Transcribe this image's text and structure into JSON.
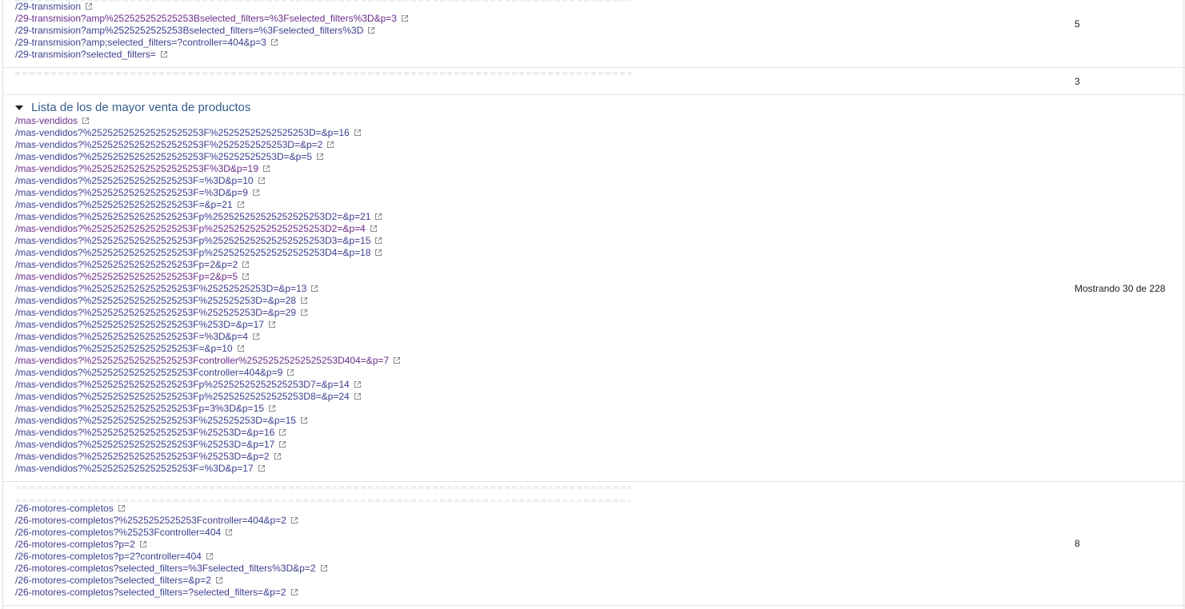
{
  "groups": [
    {
      "links": [
        {
          "url": "/29-transmision",
          "visited": false
        },
        {
          "url": "/29-transmision?amp%252525252525253Bselected_filters=%3Fselected_filters%3D&p=3",
          "visited": true
        },
        {
          "url": "/29-transmision?amp%2525252525253Bselected_filters=%3Fselected_filters%3D",
          "visited": false
        },
        {
          "url": "/29-transmision?amp;selected_filters=?controller=404&p=3",
          "visited": false
        },
        {
          "url": "/29-transmision?selected_filters=",
          "visited": false
        }
      ],
      "count": "5"
    },
    {
      "links": [],
      "count": "3"
    },
    {
      "title": "Lista de los de mayor venta de productos",
      "links": [
        {
          "url": "/mas-vendidos",
          "visited": true
        },
        {
          "url": "/mas-vendidos?%252525252525252525253F%25252525252525253D=&p=16",
          "visited": false
        },
        {
          "url": "/mas-vendidos?%252525252525252525253F%2525252525253D=&p=2",
          "visited": false
        },
        {
          "url": "/mas-vendidos?%252525252525252525253F%25252525253D=&p=5",
          "visited": false
        },
        {
          "url": "/mas-vendidos?%252525252525252525253F%3D&p=19",
          "visited": true
        },
        {
          "url": "/mas-vendidos?%2525252525252525253F=%3D&p=10",
          "visited": false
        },
        {
          "url": "/mas-vendidos?%2525252525252525253F=%3D&p=9",
          "visited": false
        },
        {
          "url": "/mas-vendidos?%2525252525252525253F=&p=21",
          "visited": false
        },
        {
          "url": "/mas-vendidos?%2525252525252525253Fp%252525252525252525253D2=&p=21",
          "visited": false
        },
        {
          "url": "/mas-vendidos?%2525252525252525253Fp%252525252525252525253D2=&p=4",
          "visited": true
        },
        {
          "url": "/mas-vendidos?%2525252525252525253Fp%252525252525252525253D3=&p=15",
          "visited": false
        },
        {
          "url": "/mas-vendidos?%2525252525252525253Fp%252525252525252525253D4=&p=18",
          "visited": false
        },
        {
          "url": "/mas-vendidos?%2525252525252525253Fp=2&p=2",
          "visited": false
        },
        {
          "url": "/mas-vendidos?%2525252525252525253Fp=2&p=5",
          "visited": true
        },
        {
          "url": "/mas-vendidos?%2525252525252525253F%25252525253D=&p=13",
          "visited": false
        },
        {
          "url": "/mas-vendidos?%2525252525252525253F%252525253D=&p=28",
          "visited": false
        },
        {
          "url": "/mas-vendidos?%2525252525252525253F%252525253D=&p=29",
          "visited": false
        },
        {
          "url": "/mas-vendidos?%2525252525252525253F%253D=&p=17",
          "visited": false
        },
        {
          "url": "/mas-vendidos?%2525252525252525253F=%3D&p=4",
          "visited": false
        },
        {
          "url": "/mas-vendidos?%2525252525252525253F=&p=10",
          "visited": false
        },
        {
          "url": "/mas-vendidos?%2525252525252525253Fcontroller%25252525252525253D404=&p=7",
          "visited": true
        },
        {
          "url": "/mas-vendidos?%2525252525252525253Fcontroller=404&p=9",
          "visited": false
        },
        {
          "url": "/mas-vendidos?%2525252525252525253Fp%25252525252525253D7=&p=14",
          "visited": false
        },
        {
          "url": "/mas-vendidos?%2525252525252525253Fp%25252525252525253D8=&p=24",
          "visited": false
        },
        {
          "url": "/mas-vendidos?%2525252525252525253Fp=3%3D&p=15",
          "visited": false
        },
        {
          "url": "/mas-vendidos?%2525252525252525253F%252525253D=&p=15",
          "visited": false
        },
        {
          "url": "/mas-vendidos?%2525252525252525253F%25253D=&p=16",
          "visited": false
        },
        {
          "url": "/mas-vendidos?%2525252525252525253F%25253D=&p=17",
          "visited": false
        },
        {
          "url": "/mas-vendidos?%2525252525252525253F%25253D=&p=2",
          "visited": false
        },
        {
          "url": "/mas-vendidos?%2525252525252525253F=%3D&p=17",
          "visited": false
        }
      ],
      "count": "Mostrando 30 de 228"
    },
    {
      "links": [
        {
          "url": "/26-motores-completos",
          "visited": false
        },
        {
          "url": "/26-motores-completos?%2525252525253Fcontroller=404&p=2",
          "visited": false
        },
        {
          "url": "/26-motores-completos?%25253Fcontroller=404",
          "visited": false
        },
        {
          "url": "/26-motores-completos?p=2",
          "visited": false
        },
        {
          "url": "/26-motores-completos?p=2?controller=404",
          "visited": false
        },
        {
          "url": "/26-motores-completos?selected_filters=%3Fselected_filters%3D&p=2",
          "visited": false
        },
        {
          "url": "/26-motores-completos?selected_filters=&p=2",
          "visited": false
        },
        {
          "url": "/26-motores-completos?selected_filters=?selected_filters=&p=2",
          "visited": false
        }
      ],
      "count": "8"
    }
  ],
  "colors": {
    "link": "#3b3f8f",
    "visited": "#6a2d8a",
    "title": "#335c8c"
  },
  "icons": {
    "external": "external-link-icon",
    "expand": "triangle-down-icon"
  }
}
